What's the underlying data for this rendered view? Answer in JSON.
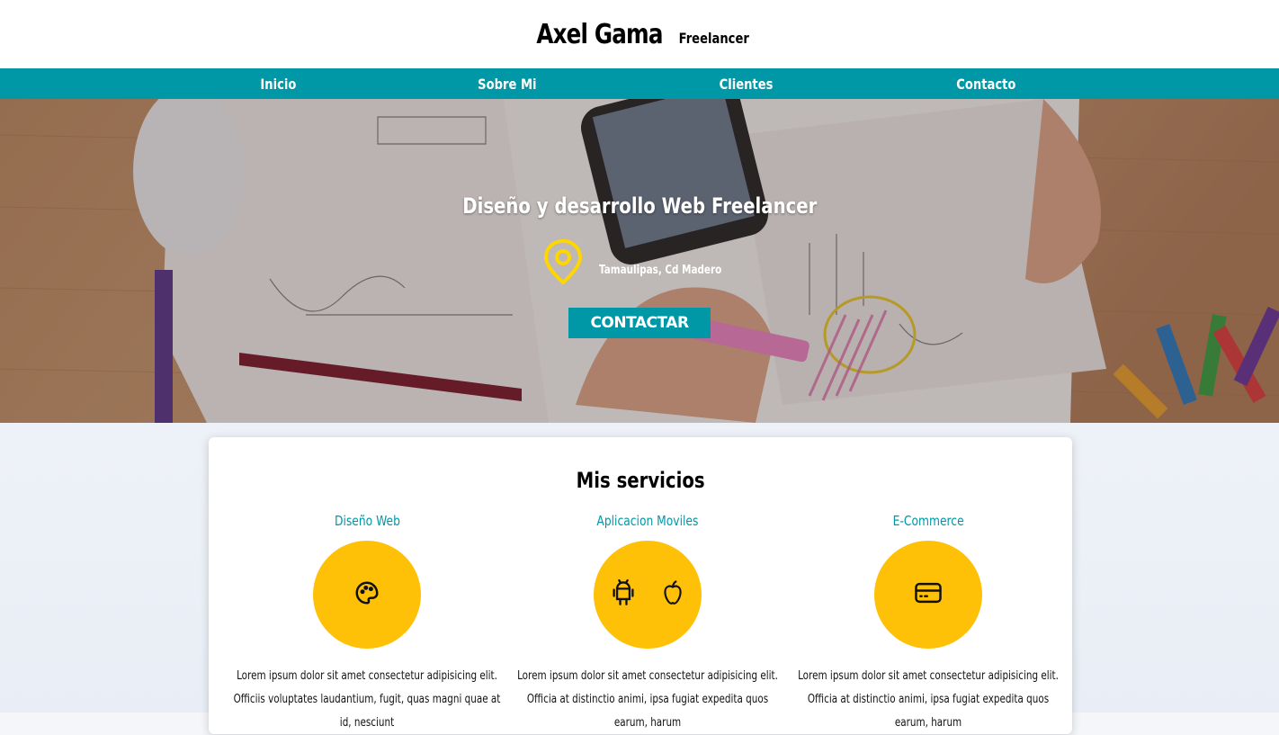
{
  "header": {
    "brand_name": "Axel Gama",
    "brand_tag": "Freelancer"
  },
  "nav": {
    "items": [
      {
        "label": "Inicio"
      },
      {
        "label": "Sobre Mi"
      },
      {
        "label": "Clientes"
      },
      {
        "label": "Contacto"
      }
    ]
  },
  "hero": {
    "title": "Diseño y desarrollo Web Freelancer",
    "location": "Tamaulipas, Cd Madero",
    "location_icon": "map-pin-icon",
    "cta_label": "Contactar"
  },
  "services": {
    "title": "Mis servicios",
    "items": [
      {
        "name": "Diseño Web",
        "icons": [
          "palette-icon"
        ],
        "description": "Lorem ipsum dolor sit amet consectetur adipisicing elit. Officiis voluptates laudantium, fugit, quas magni quae at id, nesciunt"
      },
      {
        "name": "Aplicacion Moviles",
        "icons": [
          "android-icon",
          "apple-icon"
        ],
        "description": "Lorem ipsum dolor sit amet consectetur adipisicing elit. Officia at distinctio animi, ipsa fugiat expedita quos earum, harum"
      },
      {
        "name": "E-Commerce",
        "icons": [
          "credit-card-icon"
        ],
        "description": "Lorem ipsum dolor sit amet consectetur adipisicing elit. Officia at distinctio animi, ipsa fugiat expedita quos earum, harum"
      }
    ]
  },
  "colors": {
    "accent": "#0097a7",
    "icon_circle": "#ffc107",
    "pin": "#ffd600"
  }
}
